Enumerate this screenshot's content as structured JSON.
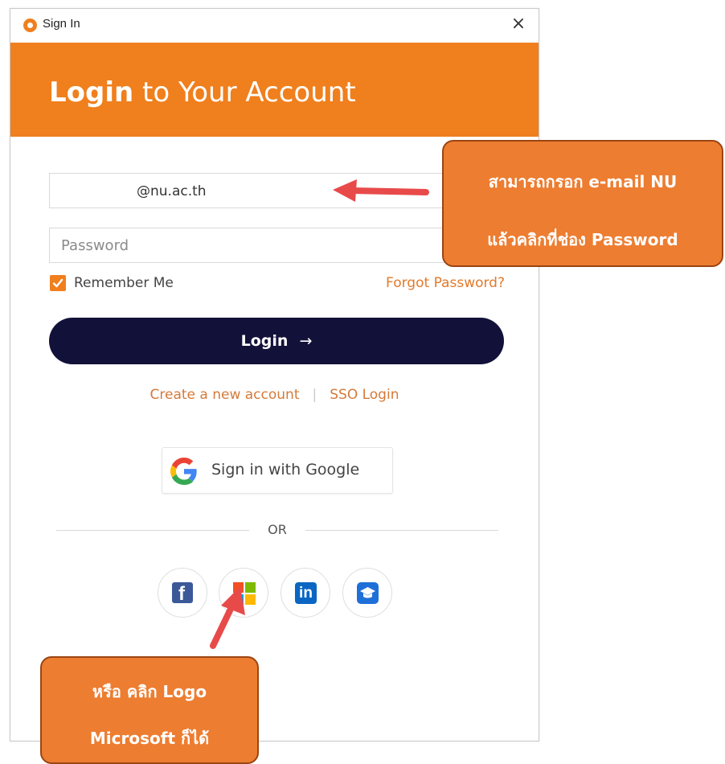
{
  "window": {
    "title": "Sign In",
    "close_symbol": "×",
    "app_icon": "app-logo-icon"
  },
  "header": {
    "title_bold": "Login",
    "title_rest": " to Your Account",
    "background_color": "#f07f1d"
  },
  "form": {
    "email_value": "@nu.ac.th",
    "password_placeholder": "Password",
    "remember_me_label": "Remember Me",
    "remember_me_checked": true,
    "forgot_password_label": "Forgot Password?",
    "login_button_label": "Login",
    "login_arrow": "→",
    "login_button_color": "#12113a"
  },
  "links": {
    "create_account": "Create a new account",
    "separator": "|",
    "sso_login": "SSO Login"
  },
  "google": {
    "label": "Sign in with Google",
    "icon": "google-icon"
  },
  "divider": {
    "text": "OR"
  },
  "social_buttons": [
    {
      "name": "facebook",
      "icon": "facebook-icon",
      "glyph": "f"
    },
    {
      "name": "microsoft",
      "icon": "microsoft-icon"
    },
    {
      "name": "linkedin",
      "icon": "linkedin-icon",
      "glyph": "in"
    },
    {
      "name": "education",
      "icon": "graduation-cap-icon"
    }
  ],
  "callouts": {
    "top_line1": "สามารถกรอก e-mail NU",
    "top_line2": "แล้วคลิกที่ช่อง Password",
    "bottom_line1": "หรือ คลิก Logo",
    "bottom_line2": "Microsoft ก็ได้",
    "callout_color": "#ed7d31",
    "arrow_color": "#e84a4a"
  }
}
